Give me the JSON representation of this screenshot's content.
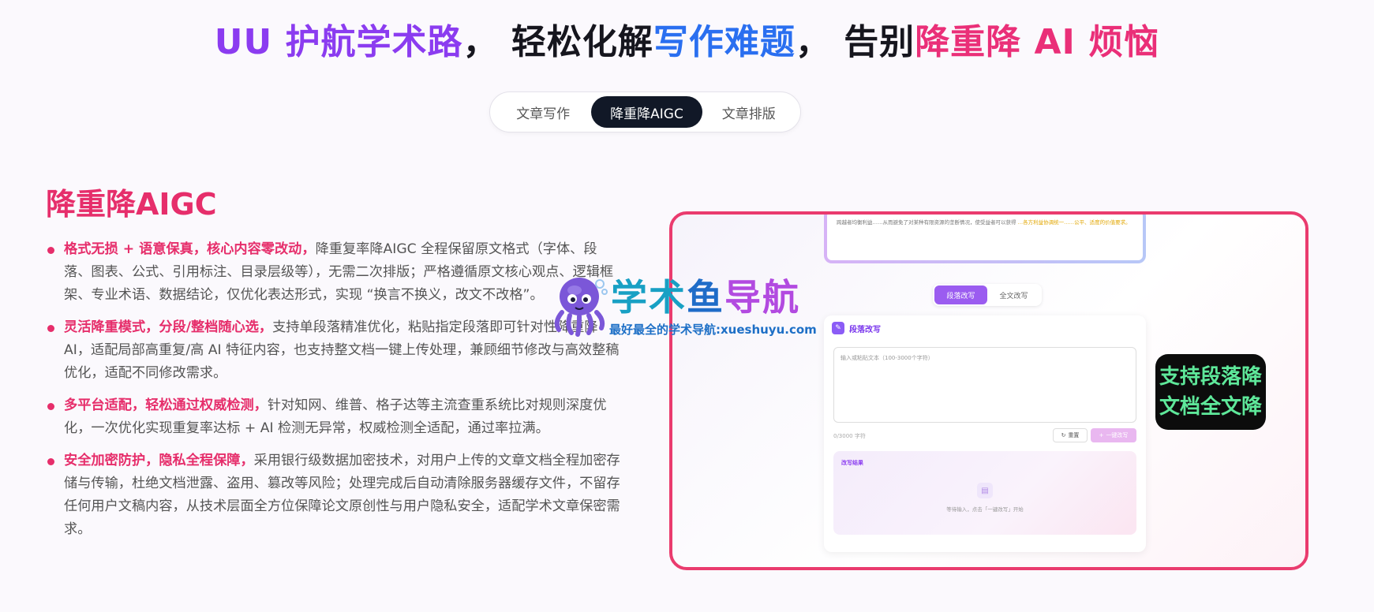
{
  "headline": {
    "part1": "UU 护航学术路",
    "comma1": "，",
    "part2": "轻松化解",
    "part3": "写作难题",
    "comma2": "，",
    "part4": "告别",
    "part5": "降重降 AI 烦恼"
  },
  "tabs": [
    {
      "label": "文章写作"
    },
    {
      "label": "降重降AIGC"
    },
    {
      "label": "文章排版"
    }
  ],
  "active_tab": "降重降AIGC",
  "section": {
    "title": "降重降AIGC",
    "features": [
      {
        "highlight": "格式无损 + 语意保真，核心内容零改动，",
        "text": "降重复率降AIGC 全程保留原文格式（字体、段落、图表、公式、引用标注、目录层级等），无需二次排版；严格遵循原文核心观点、逻辑框架、专业术语、数据结论，仅优化表达形式，实现 “换言不换义，改文不改格”。"
      },
      {
        "highlight": "灵活降重模式，分段/整档随心选，",
        "text": "支持单段落精准优化，粘贴指定段落即可针对性降重降 AI，适配局部高重复/高 AI 特征内容，也支持整文档一键上传处理，兼顾细节修改与高效整稿优化，适配不同修改需求。"
      },
      {
        "highlight": "多平台适配，轻松通过权威检测，",
        "text": "针对知网、维普、格子达等主流查重系统比对规则深度优化，一次优化实现重复率达标 + AI 检测无异常，权威检测全适配，通过率拉满。"
      },
      {
        "highlight": "安全加密防护，隐私全程保障，",
        "text": "采用银行级数据加密技术，对用户上传的文章文档全程加密存储与传输，杜绝文档泄露、盗用、篡改等风险；处理完成后自动清除服务器缓存文件，不留存任何用户文稿内容，从技术层面全方位保障论文原创性与用户隐私安全，适配学术文章保密需求。"
      }
    ]
  },
  "preview": {
    "top_text_plain": "跨越者均衡利益……从而避免了对某种有限资源的垄断情况，使受益者可以获得",
    "top_text_hl": "…各方利益协调统一……公平、适度的价值要求。",
    "modes": [
      {
        "label": "段落改写"
      },
      {
        "label": "全文改写"
      }
    ],
    "panel_title": "段落改写",
    "textarea_placeholder": "输入或粘贴文本（100-3000个字符）",
    "counter": "0/3000 字符",
    "reset_label": "重置",
    "submit_label": "一键改写",
    "result_title": "改写结果",
    "result_hint": "等待输入，点击「一键改写」开始",
    "badge_line1": "支持段落降",
    "badge_line2": "文档全文降"
  },
  "watermark": {
    "title_a": "学术",
    "title_b": "鱼",
    "title_c": "导航",
    "subtitle": "最好最全的学术导航:xueshuyu.com"
  },
  "colors": {
    "accent_pink": "#ea2f78",
    "accent_purple": "#8b3cf0",
    "accent_blue": "#2a6ff0",
    "tab_active_bg": "#111827",
    "badge_text": "#5ee89a"
  }
}
